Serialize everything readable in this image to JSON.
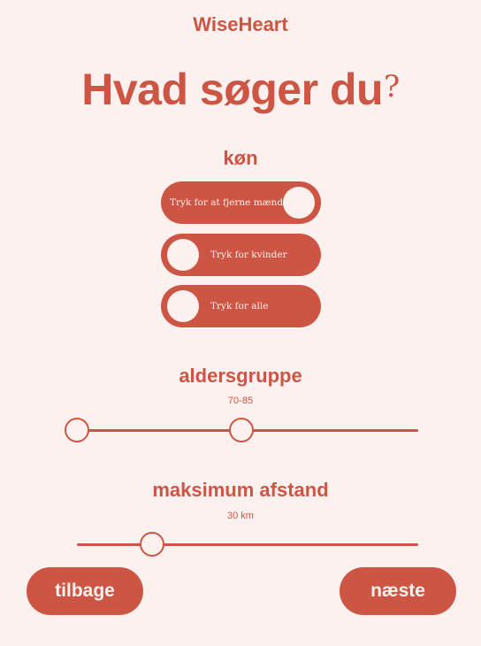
{
  "app": {
    "brand": "WiseHeart"
  },
  "headline": {
    "text": "Hvad søger du",
    "mark": "?"
  },
  "gender": {
    "label": "køn",
    "toggles": [
      {
        "label": "Tryk for at fjerne mænd",
        "state": "on"
      },
      {
        "label": "Tryk for kvinder",
        "state": "off"
      },
      {
        "label": "Tryk for alle",
        "state": "off"
      }
    ]
  },
  "age": {
    "label": "aldersgruppe",
    "value_text": "70-85",
    "range": [
      70,
      85
    ]
  },
  "distance": {
    "label": "maksimum afstand",
    "value_text": "30 km",
    "value": 30
  },
  "nav": {
    "back_label": "tilbage",
    "next_label": "næste"
  },
  "colors": {
    "accent": "#cd5543",
    "background": "#fdf1ef"
  }
}
